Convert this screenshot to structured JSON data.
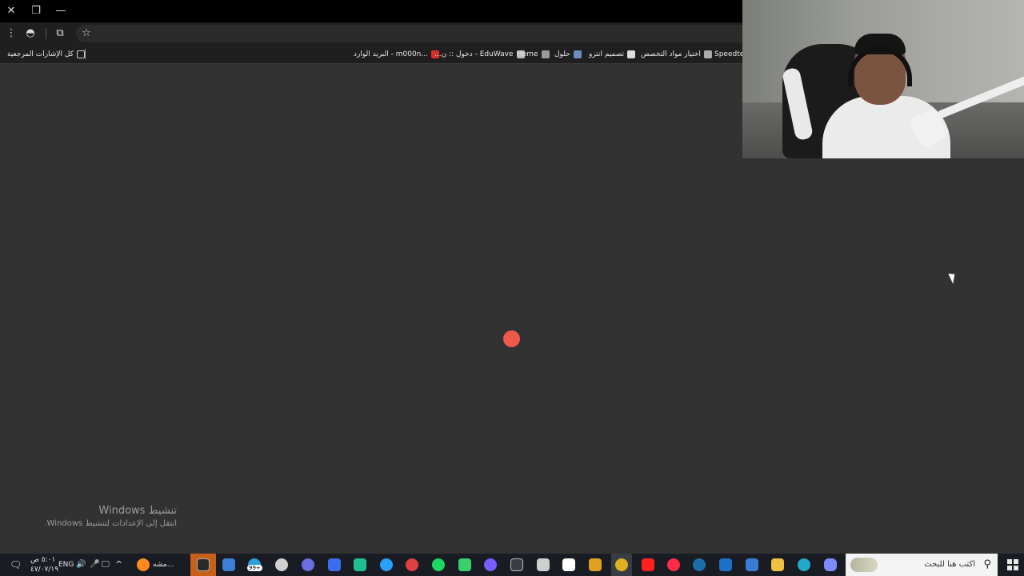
{
  "titlebar": {
    "close_glyph": "✕",
    "restore_glyph": "❐",
    "minimize_glyph": "—"
  },
  "toolbar": {
    "menu_glyph": "⋮",
    "incognito_glyph": "◓",
    "extensions_glyph": "⧉",
    "star_glyph": "☆"
  },
  "bookmarks": {
    "all_bookmarks_label": "كل الإشارات المرجعية",
    "items": [
      {
        "label": "...m000n - البريد الوارد",
        "color": "#d93025"
      },
      {
        "label": "EduWave - دخول :: ن...",
        "color": "#bcbcbc"
      },
      {
        "label": "Home",
        "color": "#9a9a9a"
      },
      {
        "label": "حلول",
        "color": "#6c8ebf"
      },
      {
        "label": "تصميم انترو",
        "color": "#dddddd"
      },
      {
        "label": "اختيار مواد التخصص",
        "color": "#aaaaaa"
      },
      {
        "label": "Speedtest",
        "color": "#ffffff"
      }
    ]
  },
  "page": {
    "loader_color": "#ee5a4a"
  },
  "activation": {
    "title": "تنشيط Windows",
    "subtitle": "انتقل إلى الإعدادات لتنشيط Windows."
  },
  "taskbar": {
    "time": "٥:٠١ ص",
    "date": "٤٧/٠٧/١٩",
    "language": "ENG",
    "browser_tab_label": "مشه...",
    "notification_glyph": "🗨",
    "search_placeholder": "اكتب هنا للبحث",
    "search_glyph": "⚲",
    "app_badge": "99+",
    "apps": [
      {
        "name": "epic-games",
        "color": "#2a2a2a"
      },
      {
        "name": "notepad",
        "color": "#3e7fd6"
      },
      {
        "name": "telegram",
        "color": "#2aa1da"
      },
      {
        "name": "speed-meter",
        "color": "#cfcfcf"
      },
      {
        "name": "voice-app",
        "color": "#6a6ee0"
      },
      {
        "name": "sketchup",
        "color": "#3a6ef0"
      },
      {
        "name": "shield-app",
        "color": "#1fbf8f"
      },
      {
        "name": "messenger",
        "color": "#28a0ff"
      },
      {
        "name": "clock-app",
        "color": "#e04040"
      },
      {
        "name": "spotify",
        "color": "#1ed760"
      },
      {
        "name": "play-app",
        "color": "#3ad16a"
      },
      {
        "name": "discord-style",
        "color": "#7a5cff"
      },
      {
        "name": "excel-like",
        "color": "#3a3c44"
      },
      {
        "name": "media-app",
        "color": "#cfcfcf"
      },
      {
        "name": "affinity",
        "color": "#ffffff"
      },
      {
        "name": "mail-app",
        "color": "#e0a020"
      },
      {
        "name": "chrome",
        "color": "#e0b020"
      },
      {
        "name": "youtube",
        "color": "#ff2020"
      },
      {
        "name": "youtube-music",
        "color": "#ff2a4a"
      },
      {
        "name": "steam",
        "color": "#1b6ea8"
      },
      {
        "name": "outlook",
        "color": "#1c70c8"
      },
      {
        "name": "store",
        "color": "#3a7bd5"
      },
      {
        "name": "file-explorer",
        "color": "#f0c040"
      },
      {
        "name": "edge",
        "color": "#22a8c8"
      },
      {
        "name": "copilot",
        "color": "#7a8cff"
      }
    ]
  }
}
